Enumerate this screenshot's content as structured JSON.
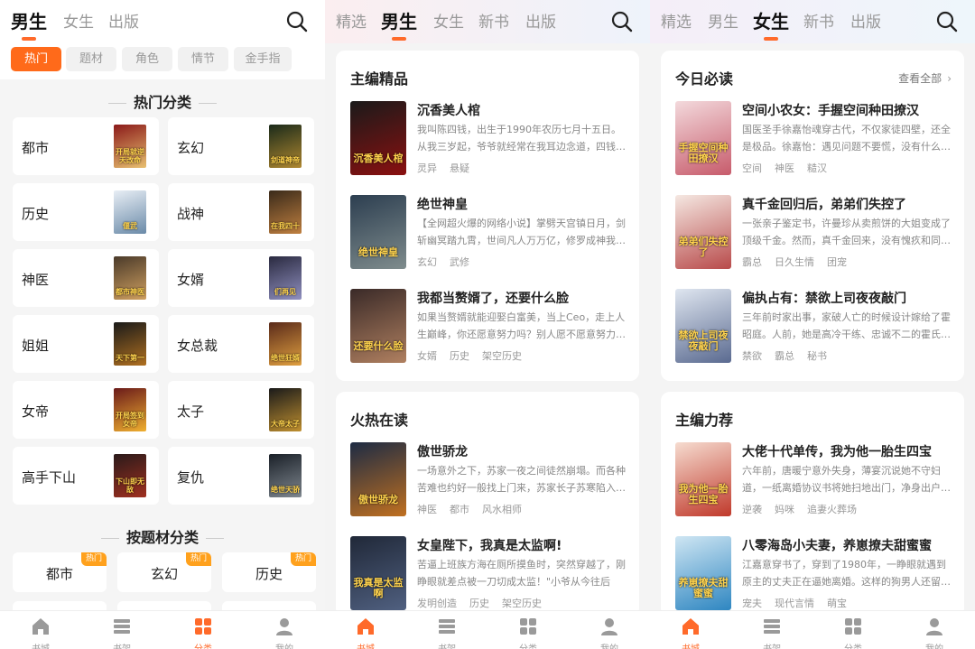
{
  "panel1": {
    "tabs": [
      {
        "label": "男生",
        "active": true
      },
      {
        "label": "女生"
      },
      {
        "label": "出版"
      }
    ],
    "chips": [
      {
        "label": "热门",
        "active": true
      },
      {
        "label": "题材"
      },
      {
        "label": "角色"
      },
      {
        "label": "情节"
      },
      {
        "label": "金手指"
      }
    ],
    "section_hot": "热门分类",
    "categories": [
      {
        "label": "都市",
        "cover_text": "开局就逆天改命"
      },
      {
        "label": "玄幻",
        "cover_text": "剑道神帝"
      },
      {
        "label": "历史",
        "cover_text": "偃武"
      },
      {
        "label": "战神",
        "cover_text": "在我四十"
      },
      {
        "label": "神医",
        "cover_text": "都市神医"
      },
      {
        "label": "女婿",
        "cover_text": "们再见"
      },
      {
        "label": "姐姐",
        "cover_text": "天下第一"
      },
      {
        "label": "女总裁",
        "cover_text": "绝世狂婿"
      },
      {
        "label": "女帝",
        "cover_text": "开局签到女帝"
      },
      {
        "label": "太子",
        "cover_text": "大帝太子"
      },
      {
        "label": "高手下山",
        "cover_text": "下山即无敌"
      },
      {
        "label": "复仇",
        "cover_text": "绝世天骄"
      }
    ],
    "section_theme": "按题材分类",
    "theme_items": [
      {
        "label": "都市",
        "badge": "热门"
      },
      {
        "label": "玄幻",
        "badge": "热门"
      },
      {
        "label": "历史",
        "badge": "热门"
      }
    ]
  },
  "panel2": {
    "tabs": [
      {
        "label": "精选"
      },
      {
        "label": "男生",
        "active": true
      },
      {
        "label": "女生"
      },
      {
        "label": "新书"
      },
      {
        "label": "出版"
      }
    ],
    "cards": [
      {
        "title": "主编精品",
        "books": [
          {
            "title": "沉香美人棺",
            "desc": "我叫陈四钱，出生于1990年农历七月十五日。从我三岁起，爷爷就经常在我耳边念道，四钱…",
            "tags": [
              "灵异",
              "悬疑"
            ],
            "cover_text": "沉香美人棺",
            "c1": "#1a1a1a",
            "c2": "#8a1010"
          },
          {
            "title": "绝世神皇",
            "desc": "【全网超火爆的网络小说】掌劈天宫镇日月，剑斩幽冥踏九霄，世间凡人万万亿，修罗成神我…",
            "tags": [
              "玄幻",
              "武修"
            ],
            "cover_text": "绝世神皇",
            "c1": "#2c3e50",
            "c2": "#7f8c8d"
          },
          {
            "title": "我都当赘婿了，还要什么脸",
            "desc": "如果当赘婿就能迎娶白富美，当上Ceo，走上人生巅峰，你还愿意努力吗？别人愿不愿意努力…",
            "tags": [
              "女婿",
              "历史",
              "架空历史"
            ],
            "cover_text": "还要什么脸",
            "c1": "#3a2a28",
            "c2": "#b08060"
          }
        ]
      },
      {
        "title": "火热在读",
        "books": [
          {
            "title": "傲世骄龙",
            "desc": "一场意外之下，苏家一夜之间徒然崩塌。而各种苦难也约好一般找上门来，苏家长子苏寒陷入…",
            "tags": [
              "神医",
              "都市",
              "风水相师"
            ],
            "cover_text": "傲世骄龙",
            "c1": "#1d2b44",
            "c2": "#c07020"
          },
          {
            "title": "女皇陛下，我真是太监啊!",
            "desc": "苦逼上班族方海在厕所摸鱼时，突然穿越了，刚睁眼就差点被一刀切成太监！\"小爷从今往后就…",
            "tags": [
              "发明创造",
              "历史",
              "架空历史"
            ],
            "cover_text": "我真是太监啊",
            "c1": "#202838",
            "c2": "#506080"
          }
        ]
      }
    ]
  },
  "panel3": {
    "tabs": [
      {
        "label": "精选"
      },
      {
        "label": "男生"
      },
      {
        "label": "女生",
        "active": true
      },
      {
        "label": "新书"
      },
      {
        "label": "出版"
      }
    ],
    "cards": [
      {
        "title": "今日必读",
        "more": "查看全部",
        "books": [
          {
            "title": "空间小农女：手握空间种田撩汉",
            "desc": "国医圣手徐嘉怡魂穿古代，不仅家徒四壁，还全是极品。徐嘉怡：遇见问题不要慌，没有什么…",
            "tags": [
              "空间",
              "神医",
              "糙汉"
            ],
            "cover_text": "手握空间种田撩汉",
            "c1": "#f3d9dc",
            "c2": "#c75b6b"
          },
          {
            "title": "真千金回归后，弟弟们失控了",
            "desc": "一张亲子鉴定书，许曼珍从卖煎饼的大姐变成了顶级千金。然而，真千金回来，没有愧疚和同…",
            "tags": [
              "霸总",
              "日久生情",
              "团宠"
            ],
            "cover_text": "弟弟们失控了",
            "c1": "#f5e8e2",
            "c2": "#b84a4a"
          },
          {
            "title": "偏执占有：禁欲上司夜夜敲门",
            "desc": "三年前时家出事，家破人亡的时候设计嫁给了霍昭庭。人前，她是高冷干练、忠诚不二的霍氏…",
            "tags": [
              "禁欲",
              "霸总",
              "秘书"
            ],
            "cover_text": "禁欲上司夜夜敲门",
            "c1": "#dfe6f0",
            "c2": "#5a6a90"
          }
        ]
      },
      {
        "title": "主编力荐",
        "books": [
          {
            "title": "大佬十代单传，我为他一胎生四宝",
            "desc": "六年前，唐暖宁意外失身，薄宴沉说她不守妇道，一纸离婚协议书将她扫地出门，净身出户…",
            "tags": [
              "逆袭",
              "妈咪",
              "追妻火葬场"
            ],
            "cover_text": "我为他一胎生四宝",
            "c1": "#f6dcd0",
            "c2": "#c0392b"
          },
          {
            "title": "八零海岛小夫妻，养崽撩夫甜蜜蜜",
            "desc": "江嘉意穿书了，穿到了1980年，一睁眼就遇到原主的丈夫正在逼她离婚。这样的狗男人还留…",
            "tags": [
              "宠夫",
              "现代言情",
              "萌宝"
            ],
            "cover_text": "养崽撩夫甜蜜蜜",
            "c1": "#cfe6f3",
            "c2": "#2e86c1"
          }
        ]
      }
    ]
  },
  "bottom_nav": [
    {
      "label": "书城",
      "icon": "home-icon"
    },
    {
      "label": "书架",
      "icon": "bookshelf-icon"
    },
    {
      "label": "分类",
      "icon": "category-icon"
    },
    {
      "label": "我的",
      "icon": "profile-icon"
    }
  ],
  "panel1_active_nav": 2,
  "panel2_active_nav": 0,
  "panel3_active_nav": 0,
  "colors": {
    "accent": "#ff6a2a",
    "badge": "#ffa11d"
  }
}
